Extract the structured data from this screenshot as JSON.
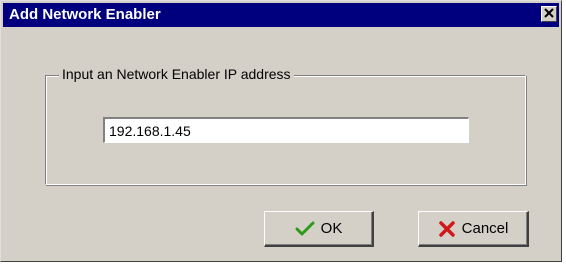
{
  "window": {
    "title": "Add Network Enabler",
    "close_icon": "close-icon"
  },
  "form": {
    "group_label": "Input an Network Enabler IP address",
    "ip_value": "192.168.1.45"
  },
  "buttons": {
    "ok_label": "OK",
    "ok_icon": "checkmark-icon",
    "cancel_label": "Cancel",
    "cancel_icon": "red-x-icon"
  },
  "colors": {
    "titlebar": "#00007f",
    "dialog_face": "#d4d0c8",
    "ok_check": "#2e9a1a",
    "cancel_x": "#d01818"
  }
}
